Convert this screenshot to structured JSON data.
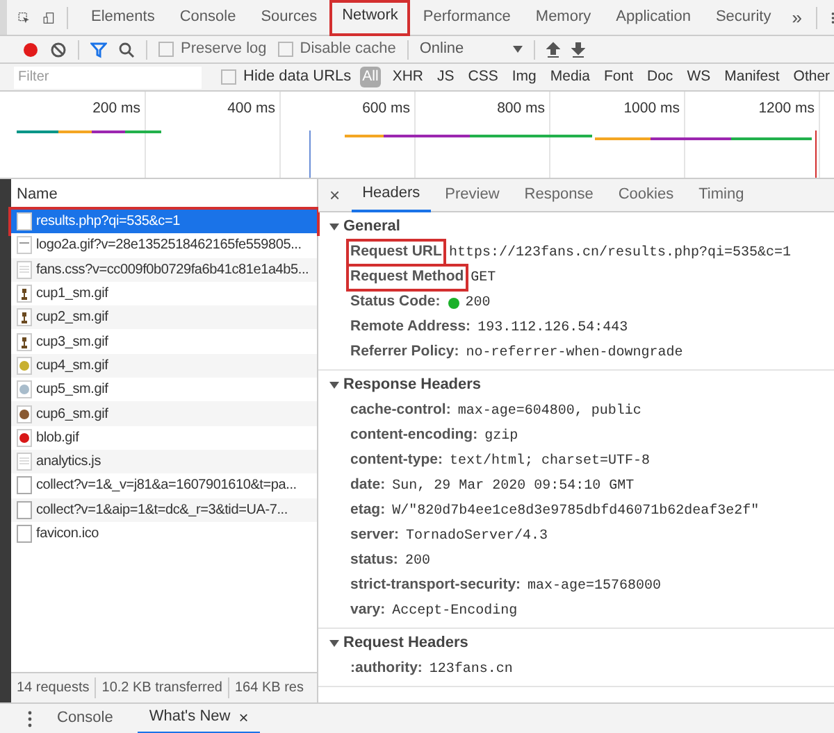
{
  "main_tabs": [
    {
      "label": "Elements",
      "selected": false,
      "highlighted": false
    },
    {
      "label": "Console",
      "selected": false,
      "highlighted": false
    },
    {
      "label": "Sources",
      "selected": false,
      "highlighted": false
    },
    {
      "label": "Network",
      "selected": true,
      "highlighted": true
    },
    {
      "label": "Performance",
      "selected": false,
      "highlighted": false
    },
    {
      "label": "Memory",
      "selected": false,
      "highlighted": false
    },
    {
      "label": "Application",
      "selected": false,
      "highlighted": false
    },
    {
      "label": "Security",
      "selected": false,
      "highlighted": false
    }
  ],
  "overflow_label": "»",
  "toolbar": {
    "recording": true,
    "filter_active": true,
    "checkboxes": [
      {
        "label": "Preserve log",
        "checked": false
      },
      {
        "label": "Disable cache",
        "checked": false
      }
    ],
    "throttling": "Online"
  },
  "filter_bar": {
    "placeholder": "Filter",
    "hide_data_urls": {
      "label": "Hide data URLs",
      "checked": false
    },
    "types": [
      {
        "label": "All",
        "selected": true
      },
      {
        "label": "XHR",
        "selected": false
      },
      {
        "label": "JS",
        "selected": false
      },
      {
        "label": "CSS",
        "selected": false
      },
      {
        "label": "Img",
        "selected": false
      },
      {
        "label": "Media",
        "selected": false
      },
      {
        "label": "Font",
        "selected": false
      },
      {
        "label": "Doc",
        "selected": false
      },
      {
        "label": "WS",
        "selected": false
      },
      {
        "label": "Manifest",
        "selected": false
      },
      {
        "label": "Other",
        "selected": false
      }
    ]
  },
  "overview": {
    "ticks": [
      "200 ms",
      "400 ms",
      "600 ms",
      "800 ms",
      "1000 ms",
      "1200 ms"
    ]
  },
  "requests": {
    "column": "Name",
    "rows": [
      {
        "name": "results.php?qi=535&c=1",
        "kind": "document",
        "selected": true,
        "highlighted": true
      },
      {
        "name": "logo2a.gif?v=28e1352518462165fe559805...",
        "kind": "image",
        "selected": false,
        "highlighted": false
      },
      {
        "name": "fans.css?v=cc009f0b0729fa6b41c81e1a4b5...",
        "kind": "stylesheet",
        "selected": false,
        "highlighted": false
      },
      {
        "name": "cup1_sm.gif",
        "kind": "cup",
        "selected": false,
        "highlighted": false
      },
      {
        "name": "cup2_sm.gif",
        "kind": "cup",
        "selected": false,
        "highlighted": false
      },
      {
        "name": "cup3_sm.gif",
        "kind": "cup",
        "selected": false,
        "highlighted": false
      },
      {
        "name": "cup4_sm.gif",
        "kind": "dot",
        "color": "#c8b030",
        "selected": false,
        "highlighted": false
      },
      {
        "name": "cup5_sm.gif",
        "kind": "dot",
        "color": "#a8bccb",
        "selected": false,
        "highlighted": false
      },
      {
        "name": "cup6_sm.gif",
        "kind": "dot",
        "color": "#8a5a32",
        "selected": false,
        "highlighted": false
      },
      {
        "name": "blob.gif",
        "kind": "dot",
        "color": "#d81818",
        "selected": false,
        "highlighted": false
      },
      {
        "name": "analytics.js",
        "kind": "stylesheet",
        "selected": false,
        "highlighted": false
      },
      {
        "name": "collect?v=1&_v=j81&a=1607901610&t=pa...",
        "kind": "blank",
        "selected": false,
        "highlighted": false
      },
      {
        "name": "collect?v=1&aip=1&t=dc&_r=3&tid=UA-7...",
        "kind": "blank",
        "selected": false,
        "highlighted": false
      },
      {
        "name": "favicon.ico",
        "kind": "blank",
        "selected": false,
        "highlighted": false
      }
    ]
  },
  "status_bar": [
    "14 requests",
    "10.2 KB transferred",
    "164 KB res"
  ],
  "detail_tabs": [
    {
      "label": "Headers",
      "selected": true
    },
    {
      "label": "Preview",
      "selected": false
    },
    {
      "label": "Response",
      "selected": false
    },
    {
      "label": "Cookies",
      "selected": false
    },
    {
      "label": "Timing",
      "selected": false
    }
  ],
  "sections": [
    {
      "title": "General",
      "expanded": true,
      "rows": [
        {
          "key": "Request URL",
          "value": "https://123fans.cn/results.php?qi=535&c=1",
          "highlighted": true,
          "has_status_dot": false
        },
        {
          "key": "Request Method",
          "value": "GET",
          "highlighted": true,
          "has_status_dot": false
        },
        {
          "key": "Status Code:",
          "value": "200",
          "highlighted": false,
          "has_status_dot": true
        },
        {
          "key": "Remote Address:",
          "value": "193.112.126.54:443",
          "highlighted": false,
          "has_status_dot": false
        },
        {
          "key": "Referrer Policy:",
          "value": "no-referrer-when-downgrade",
          "highlighted": false,
          "has_status_dot": false
        }
      ]
    },
    {
      "title": "Response Headers",
      "expanded": true,
      "rows": [
        {
          "key": "cache-control:",
          "value": "max-age=604800, public",
          "highlighted": false,
          "has_status_dot": false
        },
        {
          "key": "content-encoding:",
          "value": "gzip",
          "highlighted": false,
          "has_status_dot": false
        },
        {
          "key": "content-type:",
          "value": "text/html; charset=UTF-8",
          "highlighted": false,
          "has_status_dot": false
        },
        {
          "key": "date:",
          "value": "Sun, 29 Mar 2020 09:54:10 GMT",
          "highlighted": false,
          "has_status_dot": false
        },
        {
          "key": "etag:",
          "value": "W/\"820d7b4ee1ce8d3e9785dbfd46071b62deaf3e2f\"",
          "highlighted": false,
          "has_status_dot": false
        },
        {
          "key": "server:",
          "value": "TornadoServer/4.3",
          "highlighted": false,
          "has_status_dot": false
        },
        {
          "key": "status:",
          "value": "200",
          "highlighted": false,
          "has_status_dot": false
        },
        {
          "key": "strict-transport-security:",
          "value": "max-age=15768000",
          "highlighted": false,
          "has_status_dot": false
        },
        {
          "key": "vary:",
          "value": "Accept-Encoding",
          "highlighted": false,
          "has_status_dot": false
        }
      ]
    },
    {
      "title": "Request Headers",
      "expanded": true,
      "rows": [
        {
          "key": ":authority:",
          "value": "123fans.cn",
          "highlighted": false,
          "has_status_dot": false
        }
      ]
    }
  ],
  "drawer_tabs": [
    {
      "label": "Console",
      "selected": false,
      "closable": false
    },
    {
      "label": "What's New",
      "selected": true,
      "closable": true
    }
  ],
  "close_label": "×"
}
